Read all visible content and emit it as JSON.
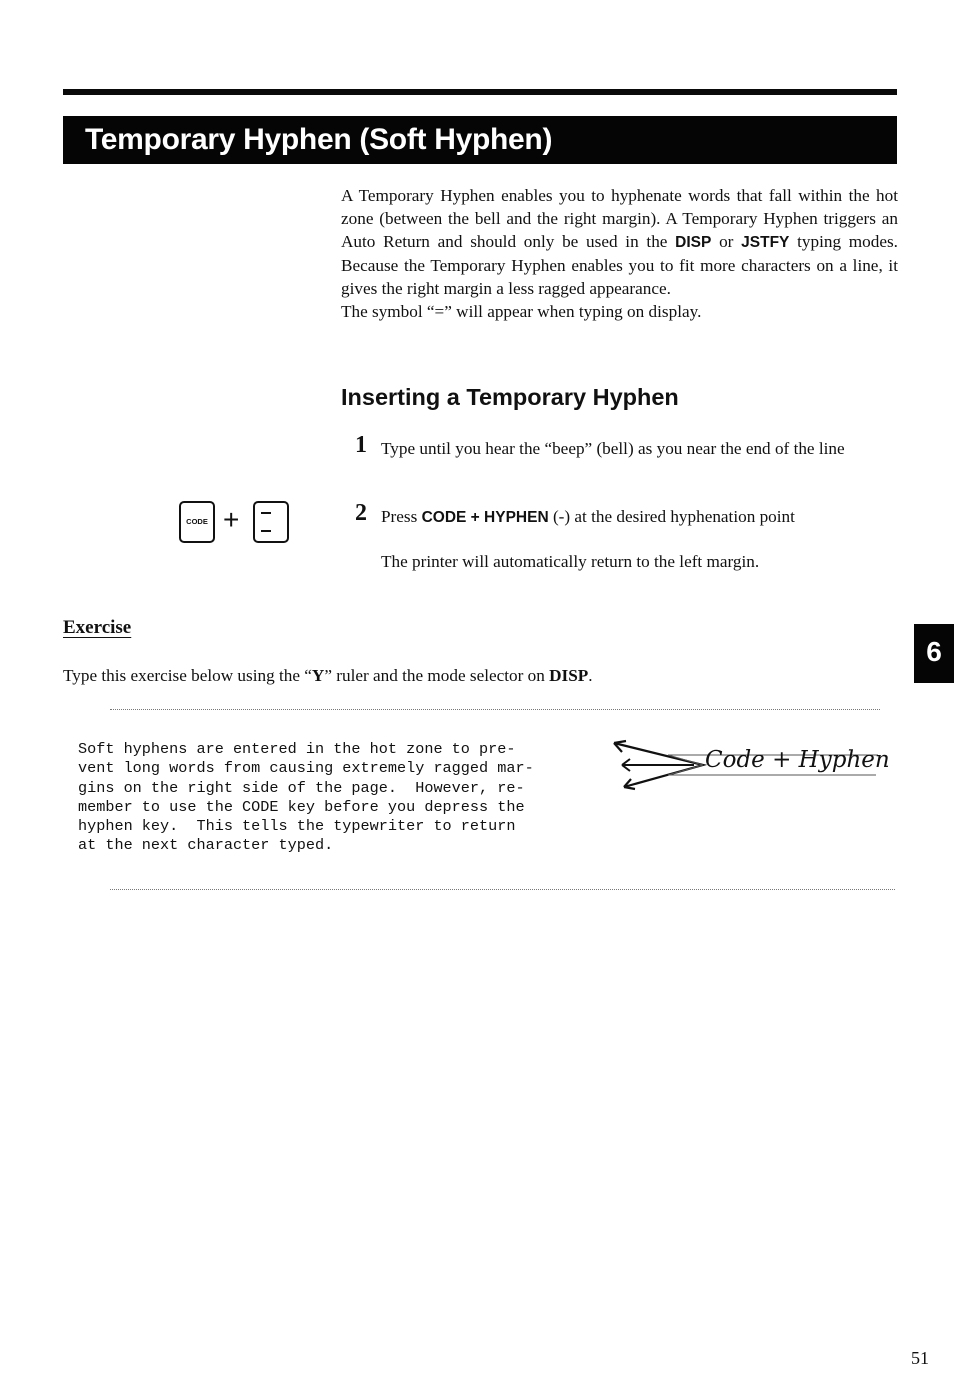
{
  "header": {
    "title": "Temporary Hyphen (Soft Hyphen)"
  },
  "intro": {
    "line_a": "A Temporary Hyphen enables you to hyphenate words that fall within the hot zone (between the bell and the right margin). A Temporary Hyphen triggers an Auto Return and should only be used in the ",
    "mode_disp": "DISP",
    "or": " or ",
    "mode_jstfy": "JSTFY",
    "line_b": " typing modes. Because the Temporary Hyphen enables you to fit more characters on a line, it gives the right margin a less ragged appearance.",
    "symbol_note": "The symbol “=” will appear when typing on display."
  },
  "section": {
    "heading": "Inserting a Temporary Hyphen",
    "steps": [
      {
        "number": "1",
        "text": "Type until you hear the “beep” (bell) as you near the end of the line"
      },
      {
        "number": "2",
        "prefix": "Press ",
        "keys": "CODE + HYPHEN",
        "suffix": " (-) at the desired hyphenation point"
      }
    ],
    "note": "The printer will automatically return to the left margin."
  },
  "key_illustration": {
    "code_key_label": "CODE",
    "plus": "+",
    "icon": "hyphen-key"
  },
  "exercise": {
    "heading": "Exercise",
    "instruction_prefix": "Type this exercise below using the “",
    "ruler": "Y",
    "instruction_middle": "” ruler and the mode selector on ",
    "mode": "DISP",
    "instruction_suffix": ".",
    "typed_lines": [
      "Soft hyphens are entered in the hot zone to pre-",
      "vent long words from causing extremely ragged mar-",
      "gins on the right side of the page.  However, re-",
      "member to use the CODE key before you depress the",
      "hyphen key.  This tells the typewriter to return",
      "at the next character typed."
    ],
    "annotation": "Code + Hyphen"
  },
  "chapter_tab": "6",
  "page_number": "51"
}
